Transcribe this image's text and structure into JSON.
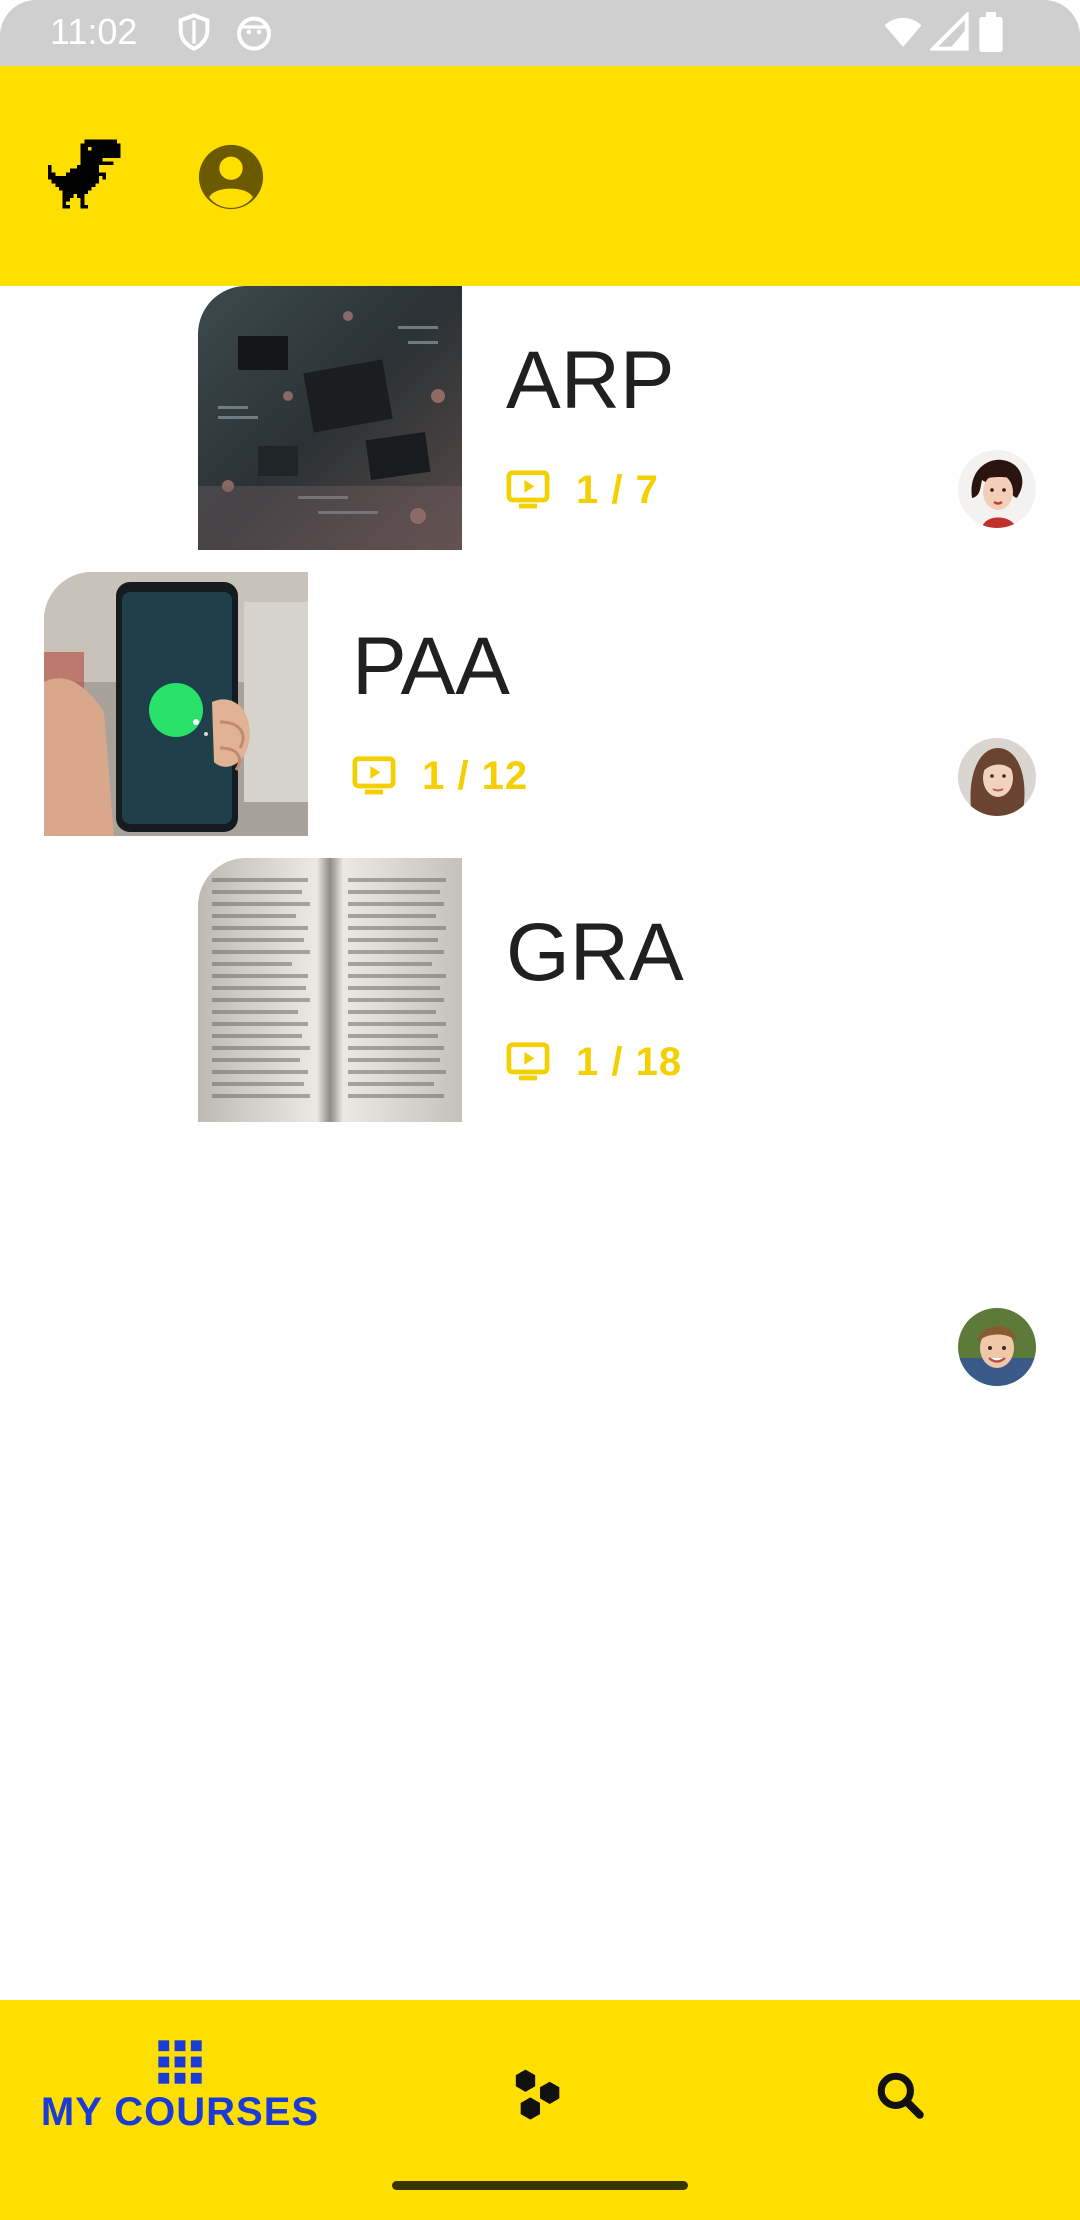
{
  "status_bar": {
    "time": "11:02",
    "icons": [
      "shield-icon",
      "android-head-icon",
      "wifi-icon",
      "cellular-signal-icon",
      "battery-icon"
    ]
  },
  "app_bar": {
    "left_icon": "dino-icon",
    "right_icon": "account-circle-icon",
    "background": "#ffdf00"
  },
  "courses": [
    {
      "title": "ARP",
      "progress": "1 / 7",
      "thumbnail": "circuit-board-photo",
      "avatar": "woman-avatar"
    },
    {
      "title": "PAA",
      "progress": "1 / 12",
      "thumbnail": "phone-in-hand-photo",
      "avatar": "young-woman-avatar"
    },
    {
      "title": "GRA",
      "progress": "1 / 18",
      "thumbnail": "open-book-photo",
      "avatar": "boy-avatar"
    }
  ],
  "bottom_nav": {
    "items": [
      {
        "label": "MY COURSES",
        "icon": "grid-icon",
        "active": true
      },
      {
        "label": "",
        "icon": "hexagons-icon",
        "active": false
      },
      {
        "label": "",
        "icon": "search-icon",
        "active": false
      }
    ],
    "active_color": "#1a3bd8",
    "background": "#ffdf00"
  },
  "colors": {
    "accent": "#ffdf00",
    "progress_text": "#f5d000",
    "title_text": "#202020"
  }
}
